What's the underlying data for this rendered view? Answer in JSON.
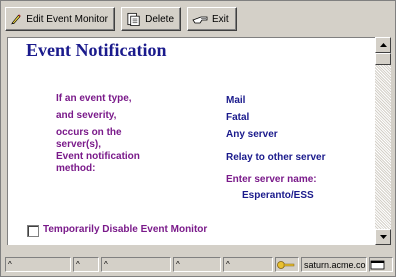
{
  "toolbar": {
    "edit_label": "Edit Event Monitor",
    "delete_label": "Delete",
    "exit_label": "Exit"
  },
  "page": {
    "title": "Event Notification"
  },
  "form": {
    "labels": [
      "If an event type,",
      "and severity,",
      "occurs on the",
      "server(s),",
      "Event notification",
      "method:"
    ],
    "values": {
      "event_type": "Mail",
      "severity": "Fatal",
      "server": "Any server",
      "method": "Relay to other server",
      "server_name_prompt": "Enter server name:",
      "server_name": "Esperanto/ESS"
    },
    "disable_label": "Temporarily Disable Event Monitor",
    "disable_checked": false
  },
  "status": {
    "server": "saturn.acme.co"
  },
  "icons": {
    "edit": "pencil-icon",
    "delete": "document-delete-icon",
    "exit": "exit-hand-icon",
    "key": "key-icon",
    "window": "window-icon"
  },
  "colors": {
    "title": "#1a1a8c",
    "label": "#7a1a8a",
    "value": "#1a1a8c",
    "chrome": "#d4d0c8"
  }
}
